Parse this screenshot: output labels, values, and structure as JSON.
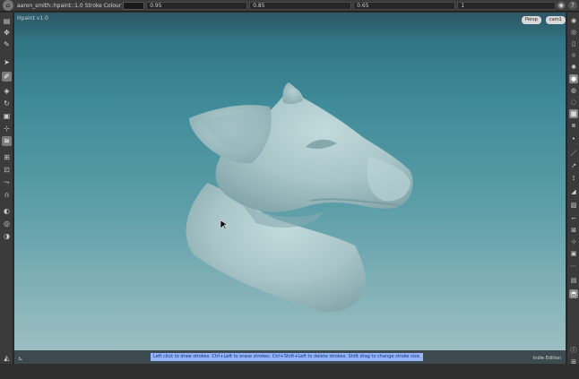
{
  "top_bar": {
    "tool_name": "aaron_smith::hpaint::1.0",
    "stroke_label": "Stroke Colour",
    "fields": [
      "0.95",
      "0.85",
      "0.65",
      "1"
    ]
  },
  "viewport": {
    "title": "Hpaint v1.0",
    "subtitle": "",
    "buttons": [
      "Persp",
      "cam1"
    ],
    "hint": "Left click to draw strokes. Ctrl+Left to erase strokes. Ctrl+Shift+Left to delete strokes. Shift drag to change stroke size.",
    "edition": "Indie Edition"
  },
  "colors": {
    "model": "#a9c6c9",
    "hint_bg": "#95b4ff"
  }
}
